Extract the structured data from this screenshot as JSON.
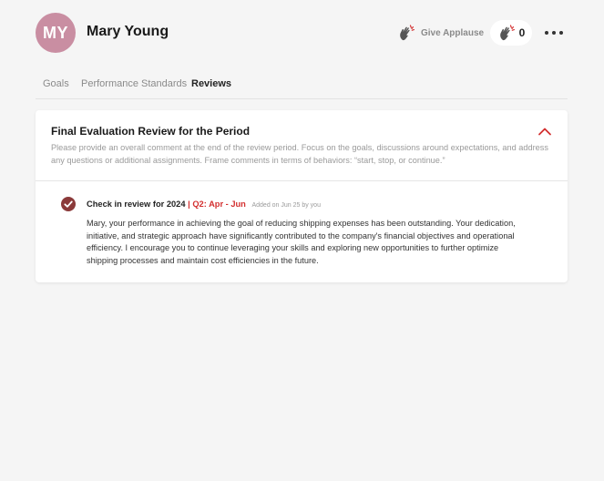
{
  "user": {
    "initials": "MY",
    "name": "Mary Young",
    "avatar_color": "#c98ea2"
  },
  "applause": {
    "button_label": "Give Applause",
    "count": "0",
    "icon": "clapping-hands-icon"
  },
  "menu": {
    "icon": "more-horizontal-icon"
  },
  "tabs": [
    {
      "label": "Goals",
      "active": false
    },
    {
      "label": "Performance Standards",
      "active": false
    },
    {
      "label": "Reviews",
      "active": true
    }
  ],
  "section": {
    "title": "Final Evaluation Review for the Period",
    "description": "Please provide an overall comment at the end of the review period. Focus on the goals, discussions around expectations, and address any questions or additional assignments. Frame comments in terms of behaviors: “start, stop, or continue.”",
    "collapse_icon": "chevron-up-icon"
  },
  "review": {
    "title": "Check in review for 2024",
    "separator": "|",
    "period": "Q2: Apr - Jun",
    "meta": "Added on Jun 25 by you",
    "body": "Mary, your performance in achieving the goal of reducing shipping expenses has been outstanding. Your dedication, initiative, and strategic approach have significantly contributed to the company's financial objectives and operational efficiency. I encourage you to continue leveraging your skills and exploring new opportunities to further optimize shipping processes and maintain cost efficiencies in the future.",
    "status_icon": "check-circle-icon"
  },
  "colors": {
    "accent_red": "#d32f2f",
    "check_brown": "#8b3a3a",
    "background": "#f5f5f5"
  }
}
